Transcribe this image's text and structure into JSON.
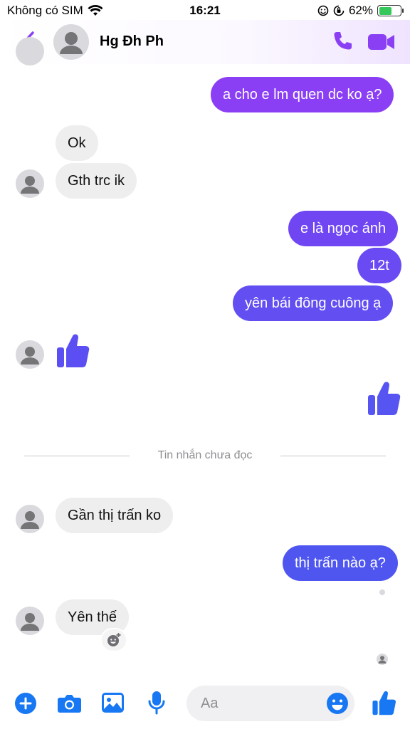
{
  "status_bar": {
    "carrier": "Không có SIM",
    "time": "16:21",
    "battery": "62%",
    "battery_level": 0.62
  },
  "header": {
    "contact_name": "Hg Đh Ph"
  },
  "messages": {
    "out_1": "a cho e lm quen dc ko ạ?",
    "in_1": "Ok",
    "in_2": "Gth trc ik",
    "out_2": "e là ngọc ánh",
    "out_3": "12t",
    "out_4": "yên bái đông cuông ạ",
    "divider": "Tin nhắn chưa đọc",
    "in_3": "Gần thị trấn ko",
    "out_5": "thị trấn nào ạ?",
    "in_4": "Yên thế"
  },
  "composer": {
    "placeholder": "Aa"
  },
  "colors": {
    "accent": "#8a3ff5",
    "accent_blue": "#4f56f0",
    "incoming_bubble": "#eeeeef"
  },
  "icons": [
    "back-icon",
    "phone-icon",
    "video-call-icon",
    "like-icon",
    "plus-icon",
    "camera-icon",
    "image-icon",
    "microphone-icon",
    "emoji-icon",
    "add-reaction-icon"
  ]
}
